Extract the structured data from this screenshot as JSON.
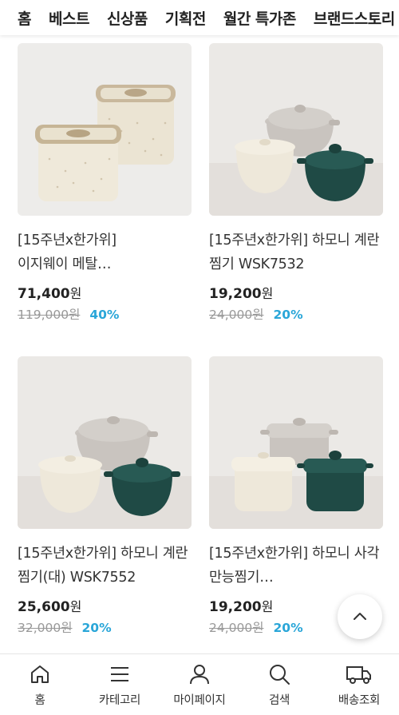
{
  "top_nav": {
    "tabs": [
      "홈",
      "베스트",
      "신상품",
      "기획전",
      "월간 특가존",
      "브랜드스토리"
    ]
  },
  "products": [
    {
      "name": "[15주년x한가위]\n이지웨이 메탈…",
      "price": "71,400",
      "currency": "원",
      "original_price": "119,000원",
      "discount": "40%",
      "image": "square-storage-containers"
    },
    {
      "name": "[15주년x한가위] 하모니 계란찜기 WSK7532",
      "price": "19,200",
      "currency": "원",
      "original_price": "24,000원",
      "discount": "20%",
      "image": "round-steamer-pots-trio"
    },
    {
      "name": "[15주년x한가위] 하모니 계란찜기(대) WSK7552",
      "price": "25,600",
      "currency": "원",
      "original_price": "32,000원",
      "discount": "20%",
      "image": "round-steamer-pots-trio-large"
    },
    {
      "name": "[15주년x한가위] 하모니 사각 만능찜기…",
      "price": "19,200",
      "currency": "원",
      "original_price": "24,000원",
      "discount": "20%",
      "image": "square-steamer-pots-trio"
    }
  ],
  "scroll_top_icon": "chevron-up-icon",
  "bottom_nav": {
    "items": [
      {
        "label": "홈",
        "icon": "home-icon"
      },
      {
        "label": "카테고리",
        "icon": "menu-icon"
      },
      {
        "label": "마이페이지",
        "icon": "user-icon"
      },
      {
        "label": "검색",
        "icon": "search-icon"
      },
      {
        "label": "배송조회",
        "icon": "truck-icon"
      }
    ]
  },
  "colors": {
    "discount": "#2aa6d8",
    "cream": "#f1ebdd",
    "dark_green": "#1e4b46",
    "grey_pot": "#c8c4bf"
  }
}
